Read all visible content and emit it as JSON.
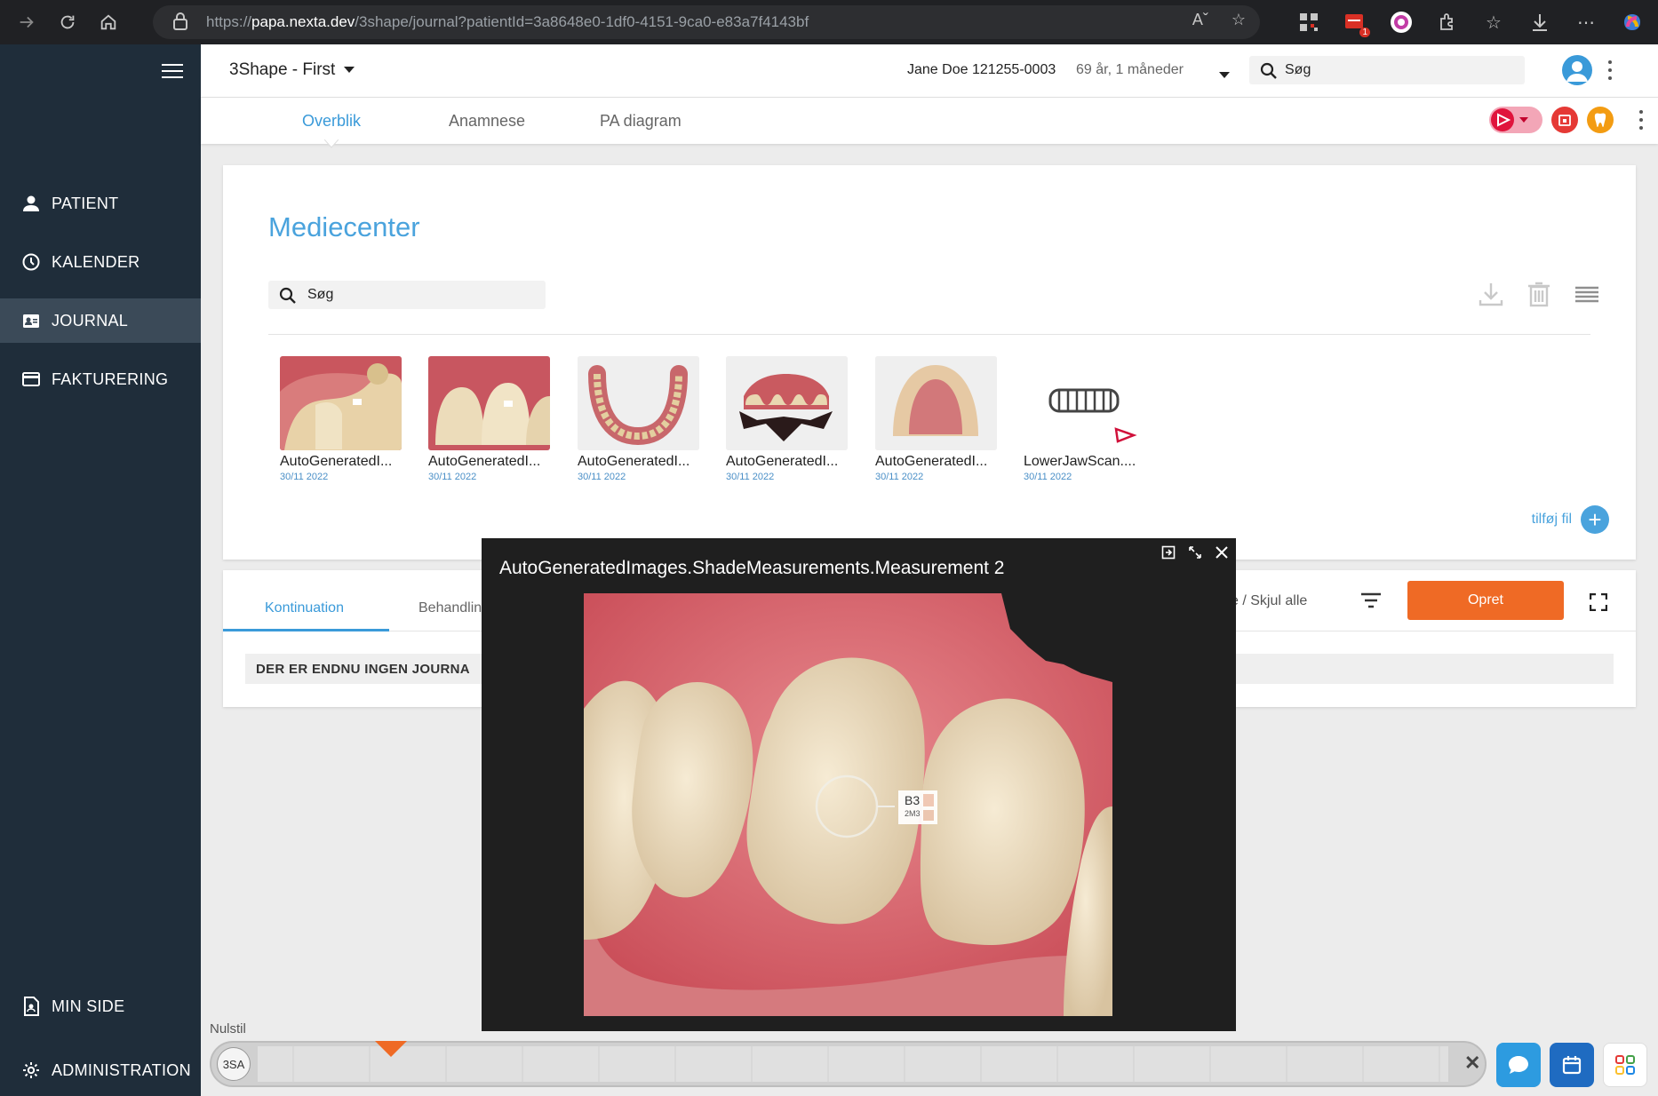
{
  "browser": {
    "url_prefix": "https://",
    "url_host": "papa.nexta.dev",
    "url_path": "/3shape/journal?patientId=3a8648e0-1df0-4151-9ca0-e83a7f4143bf",
    "ext_badge": "1"
  },
  "sidebar": {
    "items": [
      {
        "label": "PATIENT",
        "icon": "person-icon"
      },
      {
        "label": "KALENDER",
        "icon": "clock-icon"
      },
      {
        "label": "JOURNAL",
        "icon": "journal-icon"
      },
      {
        "label": "FAKTURERING",
        "icon": "card-icon"
      }
    ],
    "bottom_items": [
      {
        "label": "MIN SIDE",
        "icon": "document-icon"
      },
      {
        "label": "ADMINISTRATION",
        "icon": "gear-icon"
      }
    ]
  },
  "header": {
    "clinic": "3Shape - First",
    "patient_name": "Jane Doe 121255-0003",
    "patient_age": "69 år, 1 måneder",
    "search_placeholder": "Søg"
  },
  "tabs": [
    "Overblik",
    "Anamnese",
    "PA diagram"
  ],
  "media": {
    "title": "Mediecenter",
    "search_placeholder": "Søg",
    "add_file_label": "tilføj fil",
    "files": [
      {
        "name": "AutoGeneratedI...",
        "date": "30/11 2022"
      },
      {
        "name": "AutoGeneratedI...",
        "date": "30/11 2022"
      },
      {
        "name": "AutoGeneratedI...",
        "date": "30/11 2022"
      },
      {
        "name": "AutoGeneratedI...",
        "date": "30/11 2022"
      },
      {
        "name": "AutoGeneratedI...",
        "date": "30/11 2022"
      },
      {
        "name": "LowerJawScan....",
        "date": "30/11 2022"
      }
    ]
  },
  "journal": {
    "tabs": [
      "Kontinuation",
      "Behandlin"
    ],
    "show_hide": "e  /  Skjul alle",
    "create_label": "Opret",
    "empty_text": "DER ER ENDNU INGEN JOURNA"
  },
  "viewer": {
    "title": "AutoGeneratedImages.ShadeMeasurements.Measurement 2",
    "shade_code": "B3",
    "shade_sub": "2M3"
  },
  "timeline": {
    "reset_label": "Nulstil",
    "badge": "3SA"
  },
  "colors": {
    "sidebar_bg": "#1f2d3a",
    "accent_blue": "#4aa3dd",
    "create_orange": "#ef6a25"
  }
}
